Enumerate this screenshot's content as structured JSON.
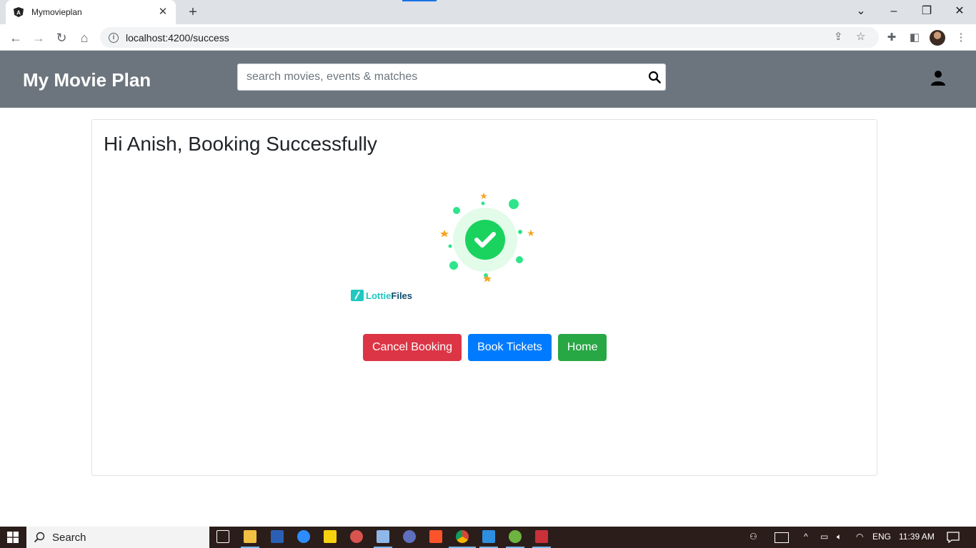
{
  "browser": {
    "tab_title": "Mymovieplan",
    "url": "localhost:4200/success"
  },
  "app": {
    "brand": "My Movie Plan",
    "search_placeholder": "search movies, events & matches"
  },
  "card": {
    "title": "Hi Anish, Booking Successfully",
    "lottie_brand_a": "Lottie",
    "lottie_brand_b": "Files"
  },
  "buttons": {
    "cancel": "Cancel Booking",
    "book": "Book Tickets",
    "home": "Home"
  },
  "colors": {
    "header": "#6c757d",
    "danger": "#dc3545",
    "primary": "#007bff",
    "success": "#28a745",
    "check": "#1ad35e"
  },
  "taskbar": {
    "search_label": "Search",
    "lang": "ENG",
    "time": "11:39 AM"
  }
}
